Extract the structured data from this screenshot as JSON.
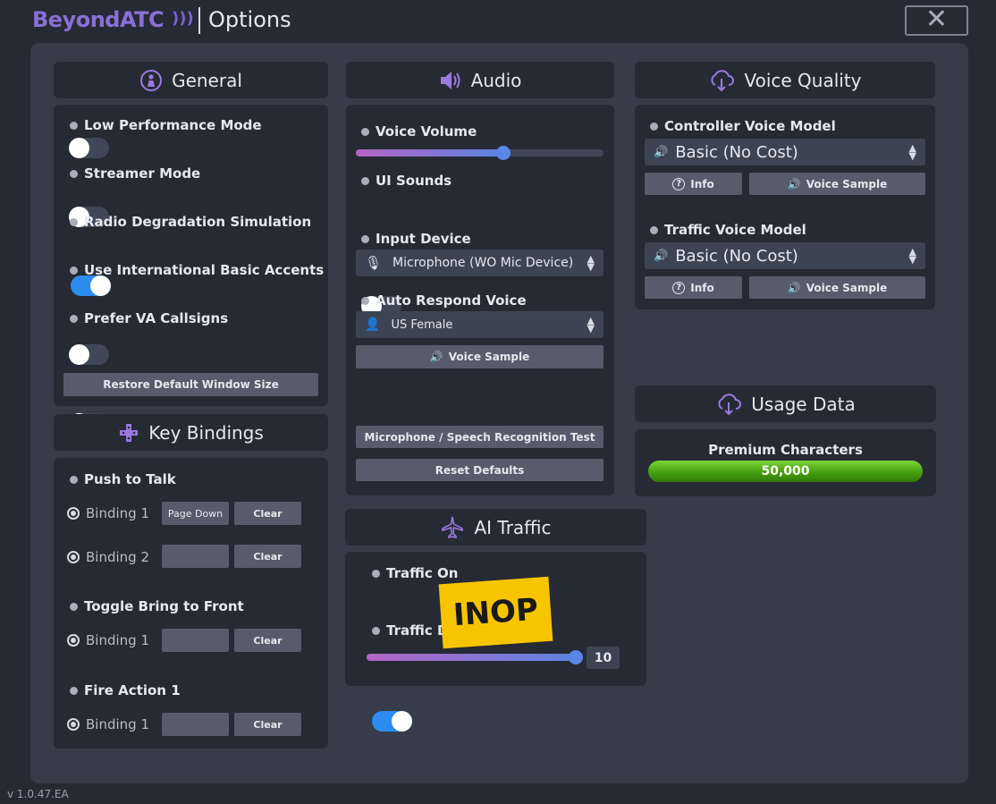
{
  "header": {
    "logo_text": "BeyondATC",
    "title": "Options",
    "close_icon": "close-icon"
  },
  "general": {
    "title": "General",
    "options": [
      {
        "label": "Low Performance Mode",
        "enabled": false
      },
      {
        "label": "Streamer Mode",
        "enabled": false
      },
      {
        "label": "Radio Degradation Simulation",
        "enabled": true
      },
      {
        "label": "Use International Basic Accents",
        "enabled": false
      },
      {
        "label": "Prefer VA Callsigns",
        "enabled": false
      }
    ],
    "restore_button": "Restore Default Window Size"
  },
  "key_bindings": {
    "title": "Key Bindings",
    "groups": [
      {
        "name": "Push to Talk",
        "b1_label": "Binding 1",
        "b1_value": "Page Down",
        "b2_label": "Binding 2",
        "b2_value": ""
      },
      {
        "name": "Toggle Bring to Front",
        "b1_label": "Binding 1",
        "b1_value": ""
      },
      {
        "name": "Fire Action 1",
        "b1_label": "Binding 1",
        "b1_value": ""
      }
    ],
    "clear_label": "Clear"
  },
  "audio": {
    "title": "Audio",
    "voice_volume_label": "Voice Volume",
    "voice_volume_level": 0.55,
    "ui_sounds_label": "UI Sounds",
    "ui_sounds_enabled": false,
    "input_device_label": "Input Device",
    "input_device_value": "Microphone (WO Mic Device)",
    "auto_respond_label": "Auto Respond Voice",
    "auto_respond_value": "US Female",
    "voice_sample_button": "Voice Sample",
    "mic_test_button": "Microphone / Speech Recognition Test",
    "reset_button": "Reset Defaults"
  },
  "voice_quality": {
    "title": "Voice Quality",
    "controller_label": "Controller Voice Model",
    "controller_value": "Basic (No Cost)",
    "traffic_label": "Traffic Voice Model",
    "traffic_value": "Basic (No Cost)",
    "info_button": "Info",
    "voice_sample_button": "Voice Sample"
  },
  "usage": {
    "title": "Usage Data",
    "premium_label": "Premium Characters",
    "premium_value": "50,000"
  },
  "ai_traffic": {
    "title": "AI Traffic",
    "traffic_on_label": "Traffic On",
    "traffic_on_enabled": true,
    "traffic_density_label": "Traffic De",
    "density_value": "10",
    "density_level": 1.0,
    "inop_label": "INOP"
  },
  "version": "v 1.0.47.EA",
  "colors": {
    "accent": "#9a7ae0",
    "toggle_on": "#2d8cf0",
    "panel": "#363c4a",
    "card": "#262a34",
    "usage_green": "#4aa312",
    "inop_yellow": "#f7c500"
  }
}
